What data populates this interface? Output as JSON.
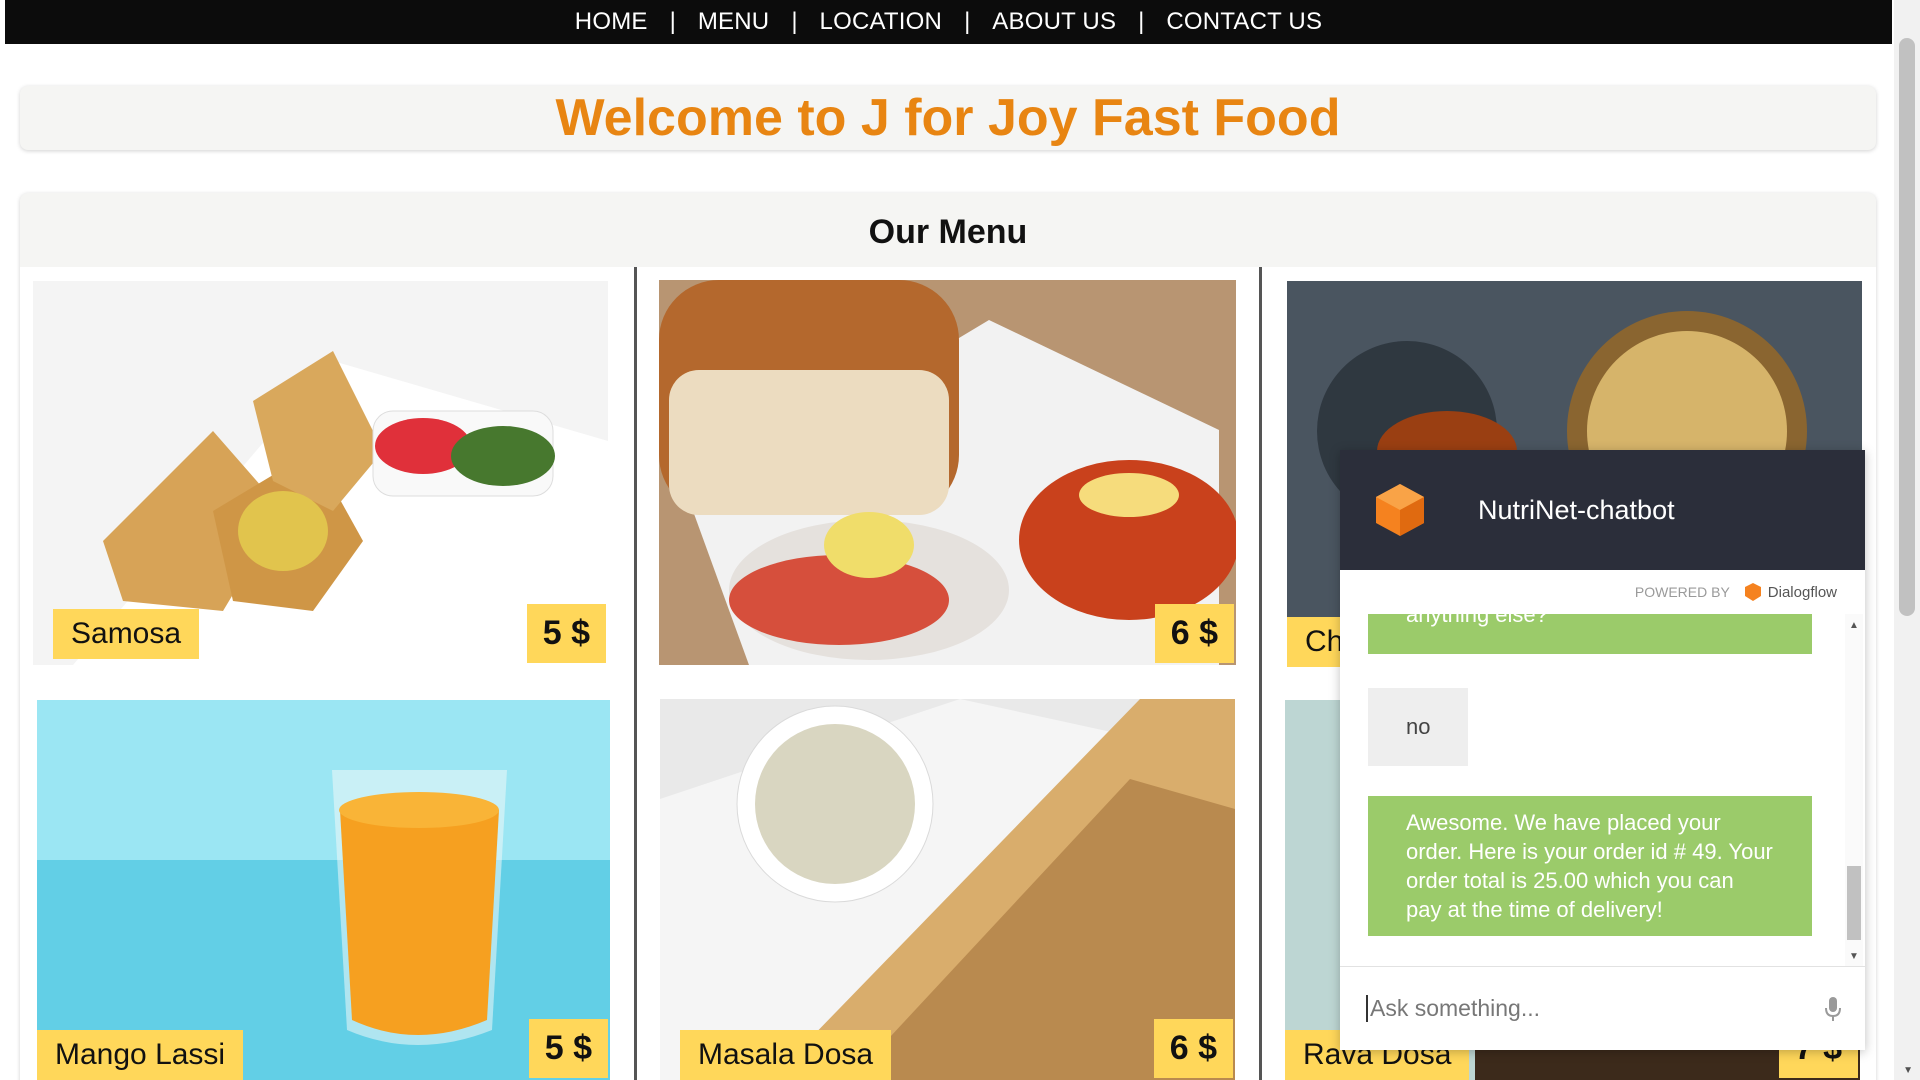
{
  "nav": {
    "items": [
      "HOME",
      "MENU",
      "LOCATION",
      "ABOUT US",
      "CONTACT US"
    ],
    "separator": "|"
  },
  "welcome": {
    "title": "Welcome to J for Joy Fast Food"
  },
  "menu": {
    "heading": "Our Menu",
    "items": [
      {
        "name": "Samosa",
        "price": "5 $"
      },
      {
        "name": "",
        "price": "6 $"
      },
      {
        "name": "Ch",
        "price": ""
      },
      {
        "name": "Mango Lassi",
        "price": "5 $"
      },
      {
        "name": "Masala Dosa",
        "price": "6 $"
      },
      {
        "name": "Rava Dosa",
        "price": "7 $"
      }
    ]
  },
  "chatbot": {
    "title": "NutriNet-chatbot",
    "powered_by": "POWERED BY",
    "powered_brand": "Dialogflow",
    "messages": [
      {
        "from": "bot",
        "text": "anything else?"
      },
      {
        "from": "user",
        "text": "no"
      },
      {
        "from": "bot",
        "text": "Awesome. We have placed your order. Here is your order id # 49. Your order total is 25.00 which you can pay at the time of delivery!"
      }
    ],
    "input_placeholder": "Ask something..."
  },
  "colors": {
    "nav_bg": "#0c0c0c",
    "title_orange": "#e88512",
    "label_yellow": "#ffd75a",
    "chat_header": "#2b2e3a",
    "bot_bubble": "#9bcb6a",
    "dialogflow_orange": "#f5821f"
  },
  "icons": [
    "dialogflow-logo-icon",
    "microphone-icon",
    "scroll-up-icon",
    "scroll-down-icon"
  ]
}
